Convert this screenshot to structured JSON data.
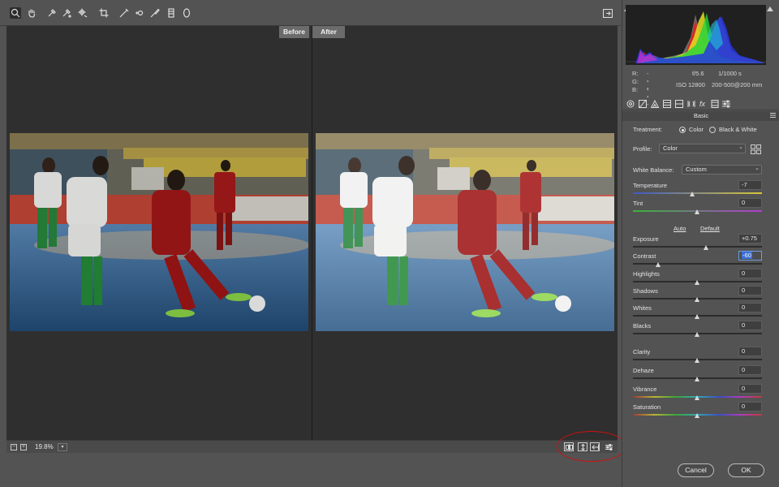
{
  "toolbar": {
    "tools": [
      "zoom-icon",
      "hand-icon",
      "white-balance-icon",
      "color-sampler-icon",
      "targeted-adjustment-icon",
      "crop-icon",
      "straighten-icon",
      "spot-removal-icon",
      "red-eye-icon",
      "adjustment-brush-icon",
      "graduated-filter-icon",
      "radial-filter-icon"
    ],
    "active_tool": "zoom-icon"
  },
  "preview": {
    "before_label": "Before",
    "after_label": "After"
  },
  "statusbar": {
    "zoom_out": "−",
    "zoom_in": "+",
    "zoom_level": "19.8%",
    "view_buttons": [
      "before-after-view-icon",
      "swap-settings-icon",
      "copy-settings-icon",
      "toggle-current-settings-icon"
    ]
  },
  "histogram": {
    "r_label": "R:",
    "r_value": "---",
    "g_label": "G:",
    "g_value": "---",
    "b_label": "B:",
    "b_value": "---",
    "aperture": "f/5.6",
    "shutter": "1/1000 s",
    "iso": "ISO 12800",
    "lens": "200-500@200 mm"
  },
  "panel": {
    "tabs": [
      "basic-icon",
      "tone-curve-icon",
      "detail-icon",
      "hsl-icon",
      "split-toning-icon",
      "lens-corrections-icon",
      "effects-icon",
      "camera-calibration-icon",
      "presets-icon"
    ],
    "section_title": "Basic",
    "treatment_label": "Treatment:",
    "treatment_color": "Color",
    "treatment_bw": "Black & White",
    "profile_label": "Profile:",
    "profile_value": "Color",
    "white_balance_label": "White Balance:",
    "white_balance_value": "Custom",
    "auto_link": "Auto",
    "default_link": "Default",
    "sliders": {
      "temperature": {
        "label": "Temperature",
        "value": "-7",
        "pos": 0.46
      },
      "tint": {
        "label": "Tint",
        "value": "0",
        "pos": 0.5
      },
      "exposure": {
        "label": "Exposure",
        "value": "+0.75",
        "pos": 0.57
      },
      "contrast": {
        "label": "Contrast",
        "value": "-60",
        "pos": 0.2
      },
      "highlights": {
        "label": "Highlights",
        "value": "0",
        "pos": 0.5
      },
      "shadows": {
        "label": "Shadows",
        "value": "0",
        "pos": 0.5
      },
      "whites": {
        "label": "Whites",
        "value": "0",
        "pos": 0.5
      },
      "blacks": {
        "label": "Blacks",
        "value": "0",
        "pos": 0.5
      },
      "clarity": {
        "label": "Clarity",
        "value": "0",
        "pos": 0.5
      },
      "dehaze": {
        "label": "Dehaze",
        "value": "0",
        "pos": 0.5
      },
      "vibrance": {
        "label": "Vibrance",
        "value": "0",
        "pos": 0.5
      },
      "saturation": {
        "label": "Saturation",
        "value": "0",
        "pos": 0.5
      }
    }
  },
  "dialog": {
    "cancel_label": "Cancel",
    "ok_label": "OK"
  },
  "colors": {
    "accent_highlight": "#d01010",
    "focus_blue": "#3a6fd8"
  }
}
